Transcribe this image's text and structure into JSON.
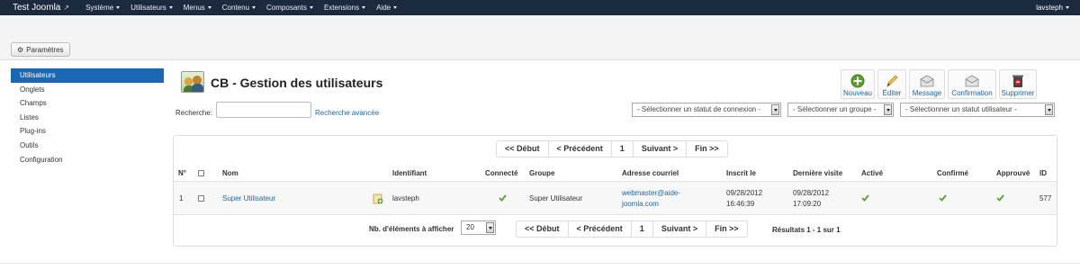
{
  "navbar": {
    "brand": "Test Joomla",
    "menu": [
      "Système",
      "Utilisateurs",
      "Menus",
      "Contenu",
      "Composants",
      "Extensions",
      "Aide"
    ],
    "user": "lavsteph"
  },
  "subheader": {
    "params_button": "Paramètres"
  },
  "sidebar": {
    "items": [
      {
        "label": "Utilisateurs",
        "active": true
      },
      {
        "label": "Onglets"
      },
      {
        "label": "Champs"
      },
      {
        "label": "Listes"
      },
      {
        "label": "Plug-ins"
      },
      {
        "label": "Outils"
      },
      {
        "label": "Configuration"
      }
    ]
  },
  "page": {
    "title": "CB - Gestion des utilisateurs"
  },
  "toolbar": {
    "new": "Nouveau",
    "edit": "Éditer",
    "message": "Message",
    "confirm": "Confirmation",
    "delete": "Supprimer"
  },
  "search": {
    "label": "Recherche:",
    "value": "",
    "advanced": "Recherche avancée"
  },
  "filters": {
    "connection": "- Sélectionner un statut de connexion -",
    "group": "- Sélectionner un groupe -",
    "user_status": "- Sélectionner un statut utilisateur -"
  },
  "pagination": {
    "first": "<< Début",
    "prev": "< Précédent",
    "page": "1",
    "next": "Suivant >",
    "last": "Fin >>"
  },
  "table": {
    "headers": {
      "num": "N°",
      "name": "Nom",
      "login": "Identifiant",
      "connected": "Connecté",
      "group": "Groupe",
      "email": "Adresse courriel",
      "registered": "Inscrit le",
      "last_visit": "Dernière visite",
      "active": "Activé",
      "confirmed": "Confirmé",
      "approved": "Approuvé",
      "id": "ID"
    },
    "rows": [
      {
        "num": "1",
        "name": "Super Utilisateur",
        "login": "lavsteph",
        "group": "Super Utilisateur",
        "email_line1": "webmaster@aide-",
        "email_line2": "joomla.com",
        "registered_date": "09/28/2012",
        "registered_time": "16:46:39",
        "last_visit_date": "09/28/2012",
        "last_visit_time": "17:09:20",
        "id": "577",
        "connected": true,
        "active": true,
        "confirmed": true,
        "approved": true
      }
    ]
  },
  "footer": {
    "per_page_label": "Nb. d'éléments à afficher",
    "per_page_value": "20",
    "results": "Résultats 1 - 1 sur 1"
  },
  "colors": {
    "navbar_bg": "#1c2a3f",
    "accent": "#1b67b3",
    "check_green": "#5aa02c",
    "delete_red": "#d0202a"
  }
}
